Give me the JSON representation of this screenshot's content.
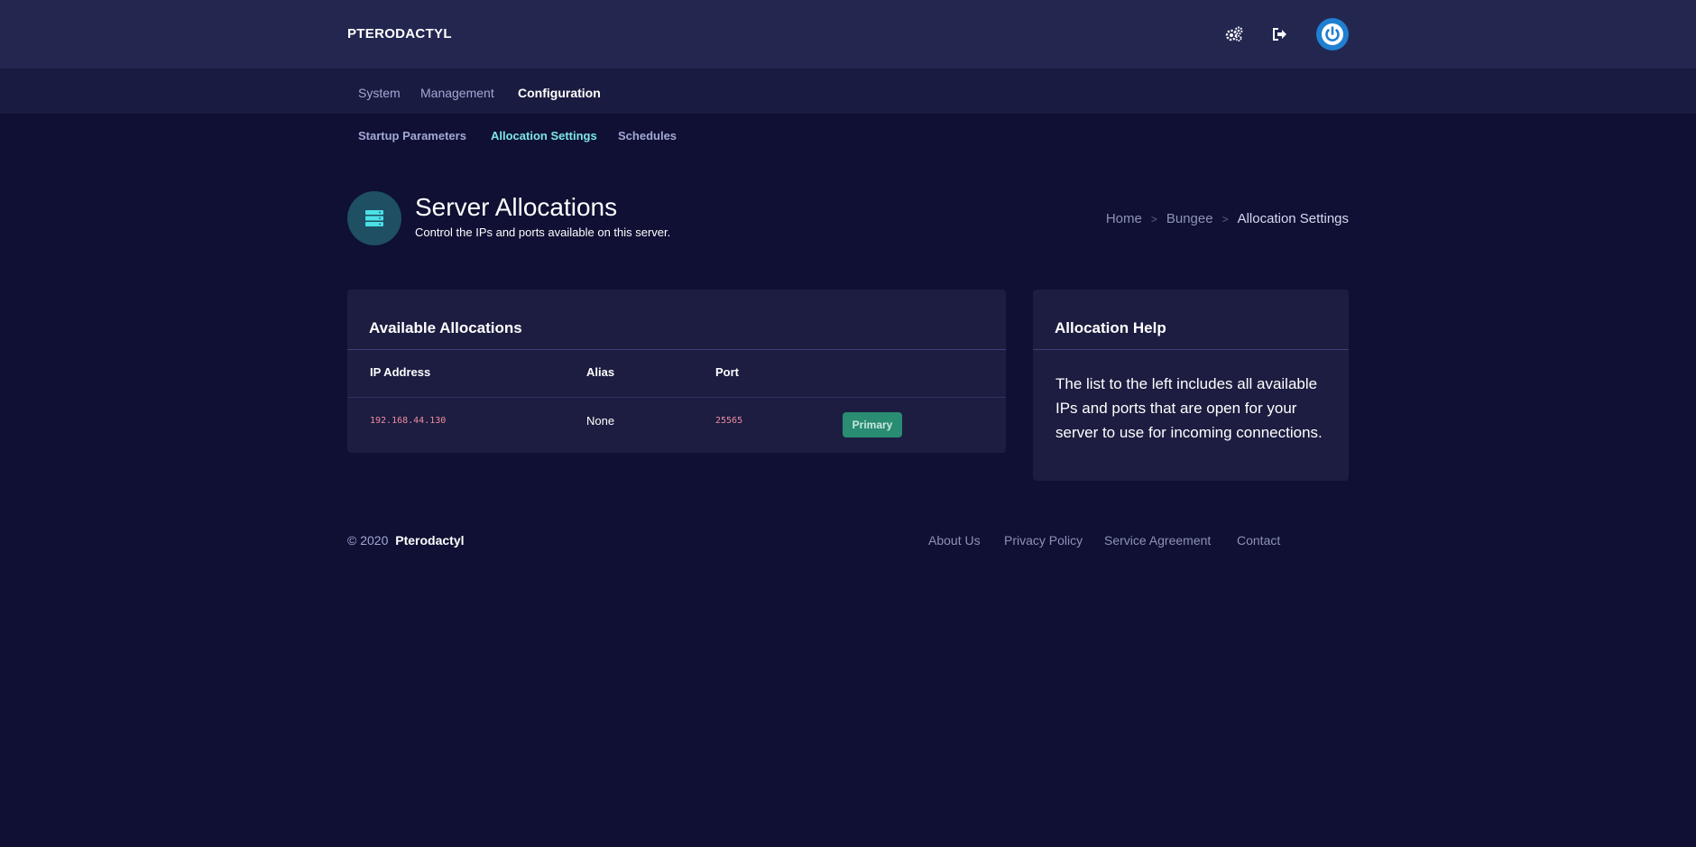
{
  "brand": "PTERODACTYL",
  "top_icons": [
    "cogs-icon",
    "sign-out-icon",
    "power-icon"
  ],
  "nav": {
    "items": [
      {
        "label": "System"
      },
      {
        "label": "Management"
      },
      {
        "label": "Configuration"
      }
    ],
    "active": "Configuration"
  },
  "subnav": {
    "items": [
      {
        "label": "Startup Parameters"
      },
      {
        "label": "Allocation Settings"
      },
      {
        "label": "Schedules"
      }
    ],
    "active": "Allocation Settings"
  },
  "header": {
    "title": "Server Allocations",
    "subtitle": "Control the IPs and ports available on this server.",
    "icon": "server-icon"
  },
  "breadcrumb": {
    "items": [
      "Home",
      "Bungee",
      "Allocation Settings"
    ],
    "separator": ">"
  },
  "allocations": {
    "title": "Available Allocations",
    "columns": [
      "IP Address",
      "Alias",
      "Port"
    ],
    "rows": [
      {
        "ip": "192.168.44.130",
        "alias": "None",
        "port": "25565",
        "badge": "Primary"
      }
    ]
  },
  "help": {
    "title": "Allocation Help",
    "text": "The list to the left includes all available IPs and ports that are open for your server to use for incoming connections."
  },
  "footer": {
    "copyright": "© 2020",
    "brand": "Pterodactyl",
    "links": [
      "About Us",
      "Privacy Policy",
      "Service Agreement",
      "Contact"
    ]
  },
  "colors": {
    "background": "#0f1033",
    "topbar": "#23264f",
    "card": "#1c1d40",
    "accent": "#7de6e6",
    "badge": "#2a8c72",
    "code": "#ef8da0"
  }
}
